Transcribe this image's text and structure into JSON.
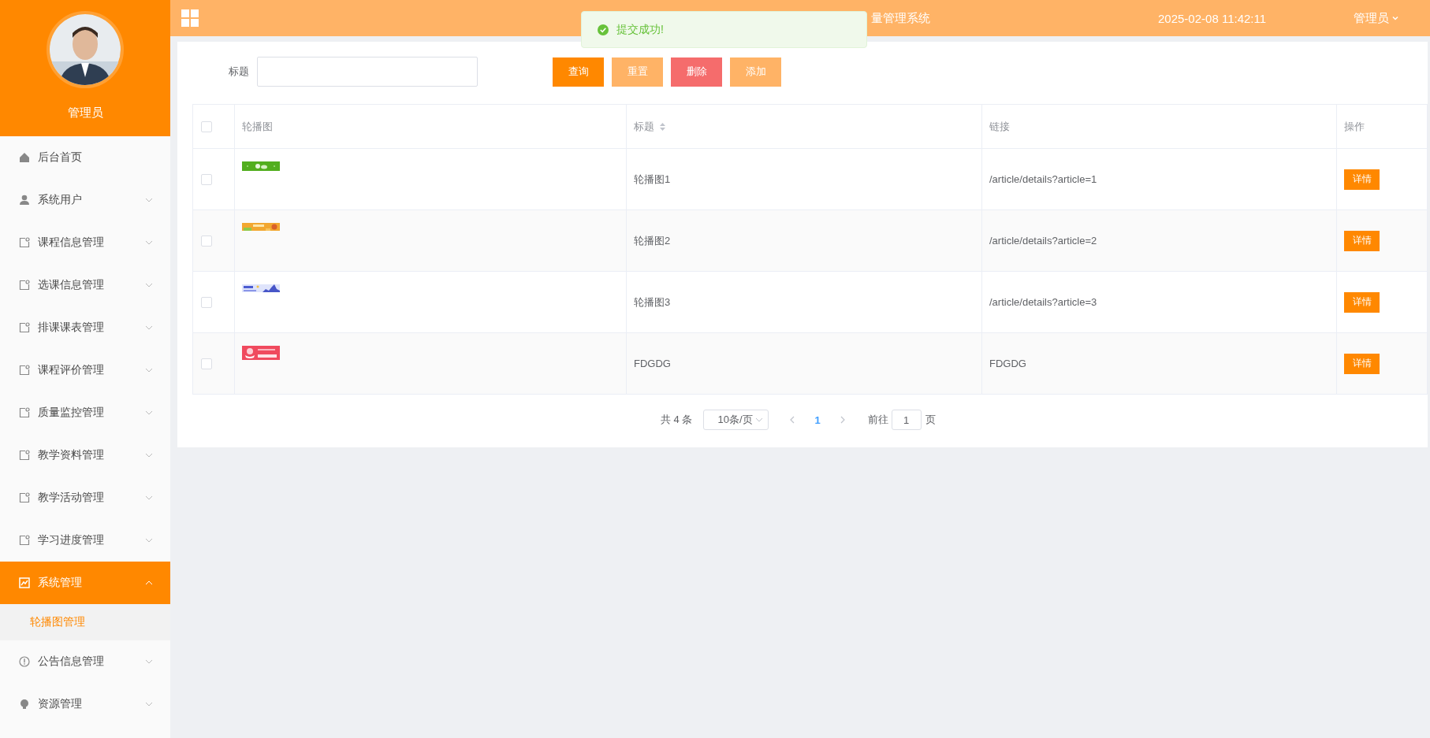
{
  "header": {
    "title": "量管理系统",
    "datetime": "2025-02-08 11:42:11",
    "user_menu": "管理员"
  },
  "toast": {
    "message": "提交成功!"
  },
  "sidebar": {
    "user_name": "管理员",
    "items": [
      {
        "label": "后台首页",
        "kind": "home",
        "has_submenu": false,
        "expanded": false,
        "selected": false
      },
      {
        "label": "系统用户",
        "kind": "user",
        "has_submenu": true,
        "expanded": false,
        "selected": false
      },
      {
        "label": "课程信息管理",
        "kind": "module",
        "has_submenu": true,
        "expanded": false,
        "selected": false
      },
      {
        "label": "选课信息管理",
        "kind": "module",
        "has_submenu": true,
        "expanded": false,
        "selected": false
      },
      {
        "label": "排课课表管理",
        "kind": "module",
        "has_submenu": true,
        "expanded": false,
        "selected": false
      },
      {
        "label": "课程评价管理",
        "kind": "module",
        "has_submenu": true,
        "expanded": false,
        "selected": false
      },
      {
        "label": "质量监控管理",
        "kind": "module",
        "has_submenu": true,
        "expanded": false,
        "selected": false
      },
      {
        "label": "教学资料管理",
        "kind": "module",
        "has_submenu": true,
        "expanded": false,
        "selected": false
      },
      {
        "label": "教学活动管理",
        "kind": "module",
        "has_submenu": true,
        "expanded": false,
        "selected": false
      },
      {
        "label": "学习进度管理",
        "kind": "module",
        "has_submenu": true,
        "expanded": false,
        "selected": false
      },
      {
        "label": "系统管理",
        "kind": "chart",
        "has_submenu": true,
        "expanded": true,
        "selected": true,
        "children": [
          {
            "label": "轮播图管理",
            "selected": true
          }
        ]
      },
      {
        "label": "公告信息管理",
        "kind": "info",
        "has_submenu": true,
        "expanded": false,
        "selected": false
      },
      {
        "label": "资源管理",
        "kind": "bulb",
        "has_submenu": true,
        "expanded": false,
        "selected": false
      }
    ]
  },
  "search": {
    "label": "标题"
  },
  "buttons": [
    {
      "label": "查询",
      "kind": "query"
    },
    {
      "label": "重置",
      "kind": "reset"
    },
    {
      "label": "删除",
      "kind": "delete"
    },
    {
      "label": "添加",
      "kind": "add"
    }
  ],
  "table": {
    "select_all_checked": false,
    "columns": [
      {
        "label": "轮播图",
        "sortable": false
      },
      {
        "label": "标题",
        "sortable": true
      },
      {
        "label": "链接",
        "sortable": false
      },
      {
        "label": "操作",
        "sortable": false
      }
    ],
    "rows": [
      {
        "checked": false,
        "title": "轮播图1",
        "link": "/article/details?article=1",
        "action": "详情"
      },
      {
        "checked": false,
        "title": "轮播图2",
        "link": "/article/details?article=2",
        "action": "详情"
      },
      {
        "checked": false,
        "title": "轮播图3",
        "link": "/article/details?article=3",
        "action": "详情"
      },
      {
        "checked": false,
        "title": "FDGDG",
        "link": "FDGDG",
        "action": "详情"
      }
    ]
  },
  "pagination": {
    "total": "共 4 条",
    "page_size": "10条/页",
    "pages": [
      {
        "label": "1",
        "selected": true
      }
    ],
    "goto_label": "前往",
    "goto_value": "1",
    "goto_suffix": "页"
  }
}
